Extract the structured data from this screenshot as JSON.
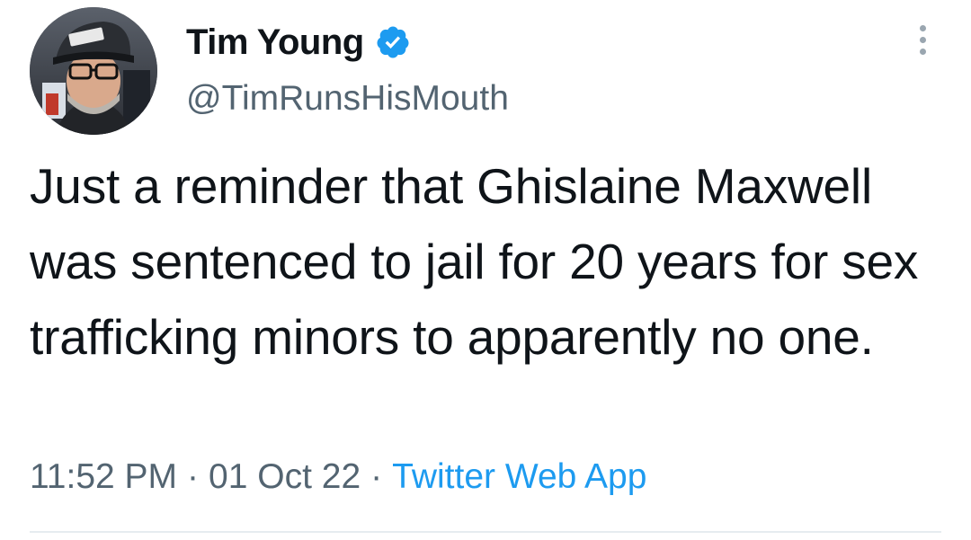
{
  "author": {
    "display_name": "Tim Young",
    "handle": "@TimRunsHisMouth",
    "verified": true,
    "avatar_icon": "user-avatar-photo"
  },
  "tweet": {
    "text": "Just a reminder that Ghislaine Maxwell was sentenced to jail for 20 years for sex trafficking minors to apparently no one.",
    "time": "11:52 PM",
    "separator": "·",
    "date": "01 Oct 22",
    "source": "Twitter Web App"
  },
  "icons": {
    "verified": "verified-badge-icon",
    "more": "more-options-icon"
  },
  "colors": {
    "text": "#0f1419",
    "secondary": "#536471",
    "accent": "#1d9bf0",
    "divider": "#e6ecf0"
  }
}
